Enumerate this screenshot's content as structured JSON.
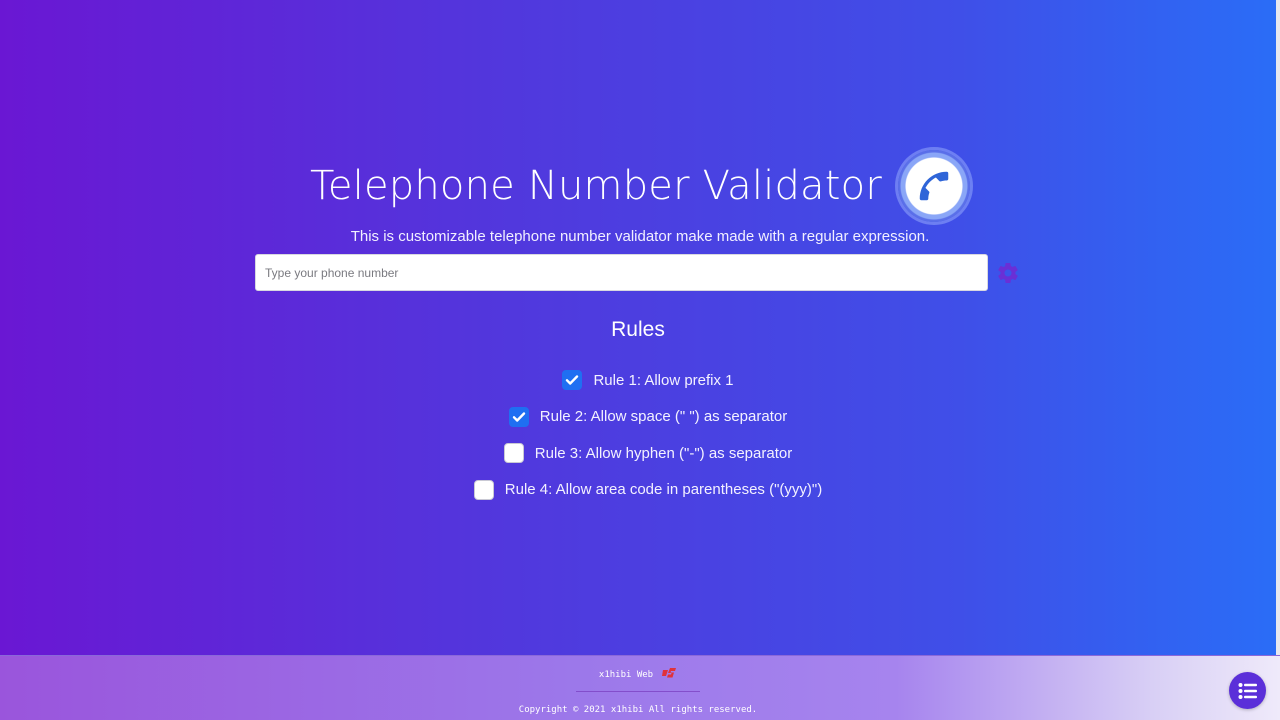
{
  "header": {
    "title": "Telephone Number Validator",
    "subtitle": "This is customizable telephone number validator make made with a regular expression.",
    "badge_icon": "phone-icon"
  },
  "input": {
    "value": "",
    "placeholder": "Type your phone number",
    "settings_icon": "gear-icon"
  },
  "rules": {
    "heading": "Rules",
    "items": [
      {
        "label": "Rule 1: Allow prefix 1",
        "checked": true
      },
      {
        "label": "Rule 2: Allow space (\" \") as separator",
        "checked": true
      },
      {
        "label": "Rule 3: Allow hyphen (\"-\") as separator",
        "checked": false
      },
      {
        "label": "Rule 4: Allow area code in parentheses (\"(yyy)\")",
        "checked": false
      }
    ]
  },
  "footer": {
    "brand": "x1hibi Web",
    "copyright": "Copyright © 2021 x1hibi All rights reserved.",
    "menu_icon": "list-icon"
  },
  "colors": {
    "accent": "#1f6ff2",
    "fab": "#5b2fd9",
    "gear": "#6a2fd6",
    "logo": "#e0323a"
  }
}
